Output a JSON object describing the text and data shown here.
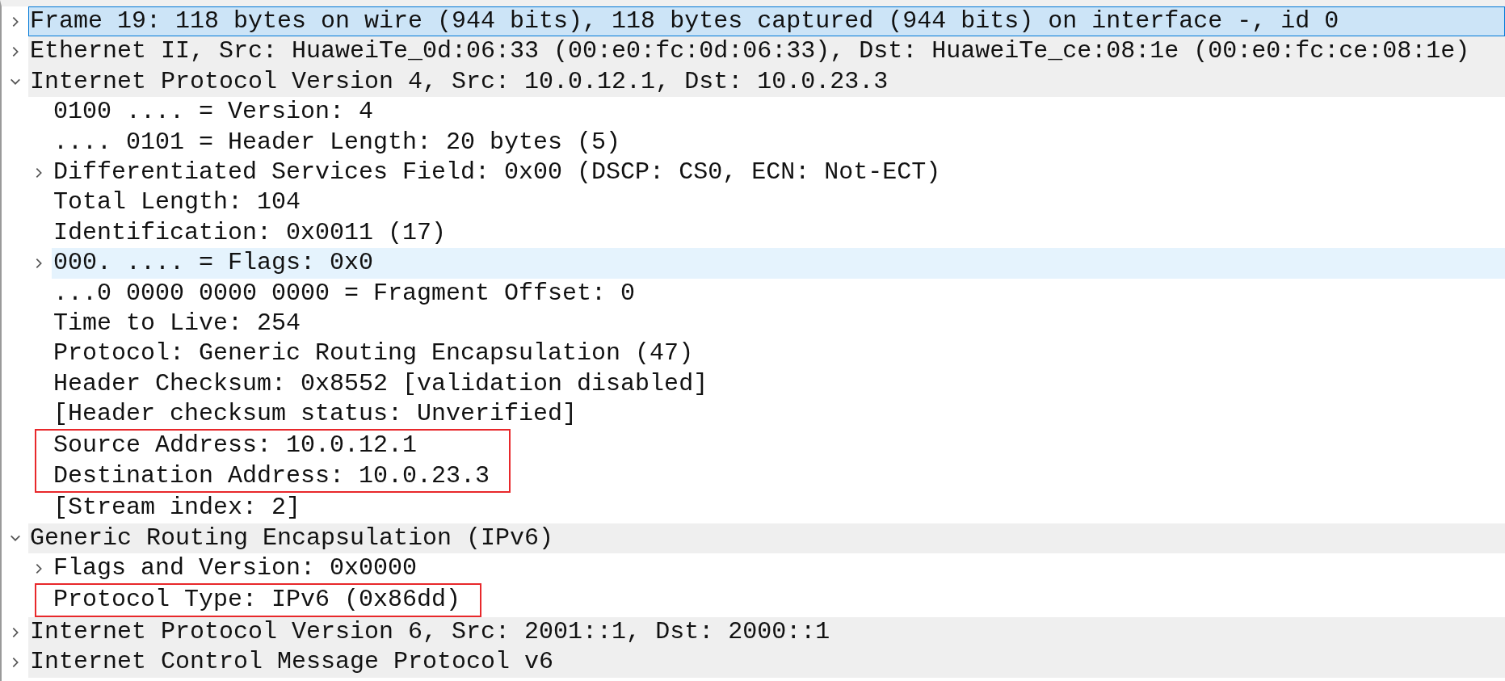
{
  "tree": [
    {
      "kind": "field",
      "label": "Frame 19: 118 bytes on wire (944 bits), 118 bytes captured (944 bits) on interface -, id 0",
      "expanded": false,
      "selected": true,
      "hovered": false
    },
    {
      "kind": "field",
      "label": "Ethernet II, Src: HuaweiTe_0d:06:33 (00:e0:fc:0d:06:33), Dst: HuaweiTe_ce:08:1e (00:e0:fc:ce:08:1e)",
      "expanded": false,
      "selected": false,
      "hovered": false
    },
    {
      "kind": "field",
      "label": "Internet Protocol Version 4, Src: 10.0.12.1, Dst: 10.0.23.3",
      "expanded": true,
      "selected": false,
      "hovered": false,
      "children": [
        {
          "kind": "field",
          "label": "0100 .... = Version: 4",
          "selected": false,
          "hovered": false
        },
        {
          "kind": "field",
          "label": ".... 0101 = Header Length: 20 bytes (5)",
          "selected": false,
          "hovered": false
        },
        {
          "kind": "field",
          "label": "Differentiated Services Field: 0x00 (DSCP: CS0, ECN: Not-ECT)",
          "expanded": false,
          "selected": false,
          "hovered": false
        },
        {
          "kind": "field",
          "label": "Total Length: 104",
          "selected": false,
          "hovered": false
        },
        {
          "kind": "field",
          "label": "Identification: 0x0011 (17)",
          "selected": false,
          "hovered": false
        },
        {
          "kind": "field",
          "label": "000. .... = Flags: 0x0",
          "expanded": false,
          "selected": false,
          "hovered": true
        },
        {
          "kind": "field",
          "label": "...0 0000 0000 0000 = Fragment Offset: 0",
          "selected": false,
          "hovered": false
        },
        {
          "kind": "field",
          "label": "Time to Live: 254",
          "selected": false,
          "hovered": false
        },
        {
          "kind": "field",
          "label": "Protocol: Generic Routing Encapsulation (47)",
          "selected": false,
          "hovered": false
        },
        {
          "kind": "field",
          "label": "Header Checksum: 0x8552 [validation disabled]",
          "selected": false,
          "hovered": false
        },
        {
          "kind": "field",
          "label": "[Header checksum status: Unverified]",
          "selected": false,
          "hovered": false
        },
        {
          "kind": "box",
          "children": [
            {
              "kind": "field",
              "label": "Source Address: 10.0.12.1",
              "selected": false,
              "hovered": false
            },
            {
              "kind": "field",
              "label": "Destination Address: 10.0.23.3",
              "selected": false,
              "hovered": false
            }
          ]
        },
        {
          "kind": "field",
          "label": "[Stream index: 2]",
          "selected": false,
          "hovered": false
        }
      ]
    },
    {
      "kind": "field",
      "label": "Generic Routing Encapsulation (IPv6)",
      "expanded": true,
      "selected": false,
      "hovered": false,
      "children": [
        {
          "kind": "field",
          "label": "Flags and Version: 0x0000",
          "expanded": false,
          "selected": false,
          "hovered": false
        },
        {
          "kind": "box",
          "children": [
            {
              "kind": "field",
              "label": "Protocol Type: IPv6 (0x86dd)",
              "selected": false,
              "hovered": false
            }
          ]
        }
      ]
    },
    {
      "kind": "field",
      "label": "Internet Protocol Version 6, Src: 2001::1, Dst: 2000::1",
      "expanded": false,
      "selected": false,
      "hovered": false
    },
    {
      "kind": "field",
      "label": "Internet Control Message Protocol v6",
      "expanded": false,
      "selected": false,
      "hovered": false
    }
  ]
}
